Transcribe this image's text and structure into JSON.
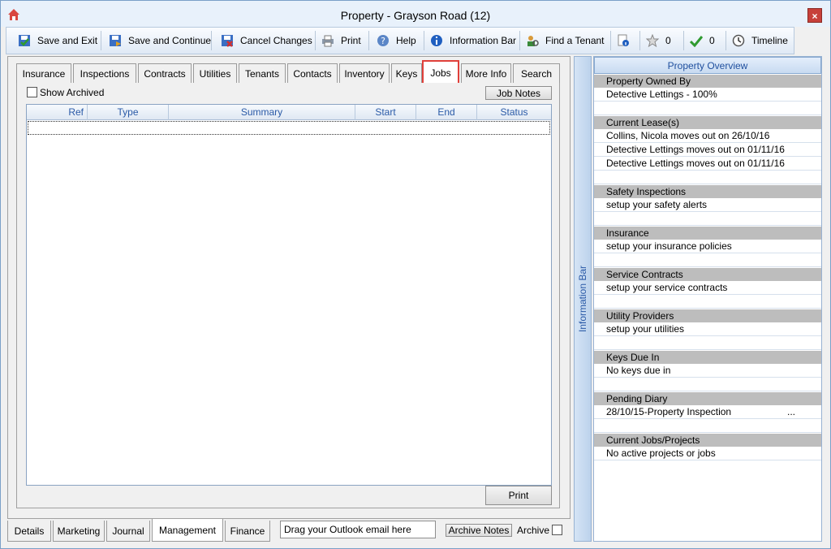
{
  "window": {
    "title": "Property  - Grayson Road (12)",
    "close_label": "×"
  },
  "toolbar": {
    "save_exit": "Save and Exit",
    "save_continue": "Save and Continue",
    "cancel_changes": "Cancel Changes",
    "print": "Print",
    "help": "Help",
    "information_bar": "Information Bar",
    "find_tenant": "Find a Tenant",
    "star_count": "0",
    "check_count": "0",
    "timeline": "Timeline"
  },
  "tabs": [
    "Insurance",
    "Inspections",
    "Contracts",
    "Utilities",
    "Tenants",
    "Contacts",
    "Inventory",
    "Keys",
    "Jobs",
    "More Info",
    "Search"
  ],
  "active_tab": "Jobs",
  "jobs": {
    "show_archived_label": "Show Archived",
    "job_notes_label": "Job Notes",
    "columns": [
      "Ref",
      "Type",
      "Summary",
      "Start",
      "End",
      "Status"
    ],
    "rows": [],
    "print_label": "Print"
  },
  "bottom_tabs": [
    "Details",
    "Marketing",
    "Journal",
    "Management",
    "Finance"
  ],
  "active_bottom_tab": "Management",
  "bottom_bar": {
    "drag_placeholder": "Drag your Outlook email here",
    "archive_notes_label": "Archive Notes",
    "archive_label": "Archive"
  },
  "info_strip_label": "Information Bar",
  "overview": {
    "title": "Property Overview",
    "sections": [
      {
        "name": "Property Owned By",
        "items": [
          "Detective Lettings - 100%"
        ]
      },
      {
        "name": "Current Lease(s)",
        "items": [
          "Collins, Nicola moves out on 26/10/16",
          "Detective Lettings moves out on 01/11/16",
          "Detective Lettings moves out on 01/11/16"
        ]
      },
      {
        "name": "Safety Inspections",
        "items": [
          "setup your safety alerts"
        ]
      },
      {
        "name": "Insurance",
        "items": [
          "setup your insurance policies"
        ]
      },
      {
        "name": "Service Contracts",
        "items": [
          "setup your service contracts"
        ]
      },
      {
        "name": "Utility Providers",
        "items": [
          "setup your utilities"
        ]
      },
      {
        "name": "Keys Due In",
        "items": [
          "No keys due in"
        ]
      },
      {
        "name": "Pending Diary",
        "items": [
          "28/10/15-Property Inspection"
        ],
        "item_suffix": "..."
      },
      {
        "name": "Current Jobs/Projects",
        "items": [
          "No active projects or jobs"
        ]
      }
    ]
  }
}
